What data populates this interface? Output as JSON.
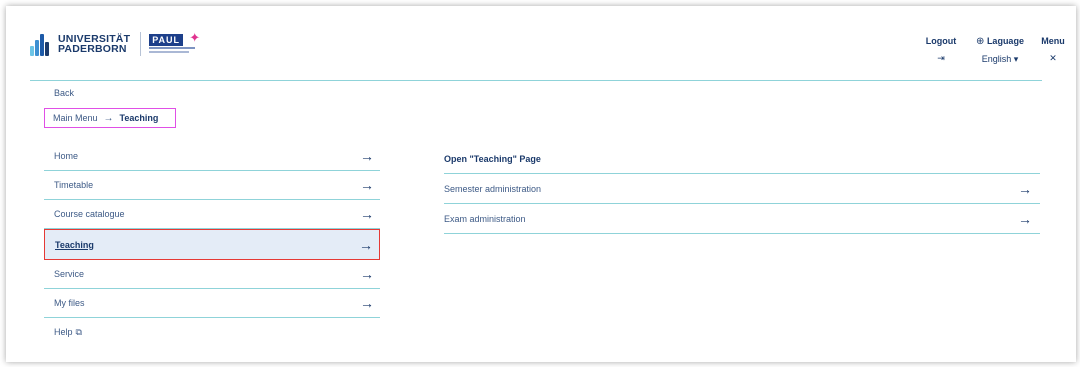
{
  "header": {
    "logo": {
      "uni_line1": "UNIVERSITÄT",
      "uni_line2": "PADERBORN",
      "paul": "PAUL"
    },
    "logout": {
      "label": "Logout",
      "icon": "logout-icon"
    },
    "language": {
      "label": "Laguage",
      "icon": "globe-icon",
      "selected": "English"
    },
    "menu": {
      "label": "Menu",
      "icon": "close-icon"
    }
  },
  "back": "Back",
  "breadcrumb": {
    "root": "Main Menu",
    "current": "Teaching"
  },
  "menu_items": [
    {
      "label": "Home"
    },
    {
      "label": "Timetable"
    },
    {
      "label": "Course catalogue"
    },
    {
      "label": "Teaching",
      "active": true
    },
    {
      "label": "Service"
    },
    {
      "label": "My files"
    },
    {
      "label": "Help"
    }
  ],
  "panel": {
    "title": "Open \"Teaching\" Page",
    "items": [
      {
        "label": "Semester administration"
      },
      {
        "label": "Exam administration"
      }
    ]
  },
  "colors": {
    "accent_rule": "#8fd3d9",
    "highlight_breadcrumb": "#e04fe6",
    "highlight_active": "#e53935",
    "brand_blue": "#1b3a6b"
  }
}
